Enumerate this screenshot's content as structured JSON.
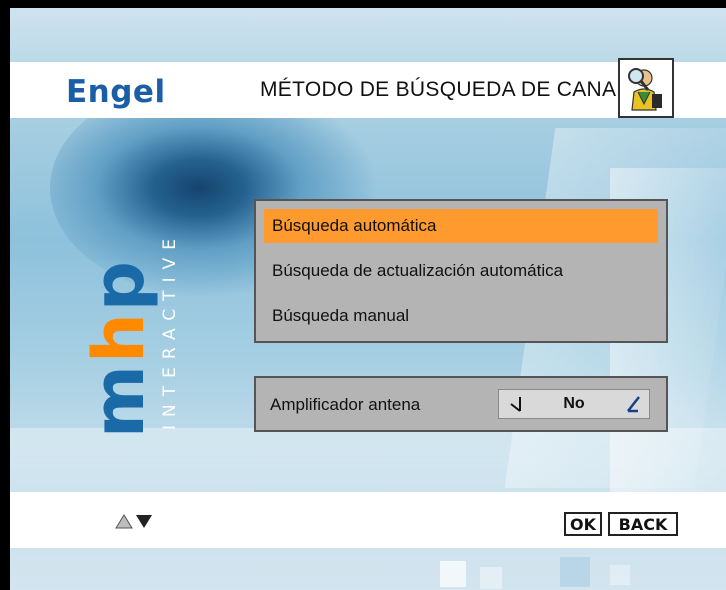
{
  "header": {
    "brand": "Engel",
    "title": "MÉTODO DE BÚSQUEDA DE CANALES",
    "icon": "user-with-magnifier-icon"
  },
  "logo": {
    "mhp": "m",
    "mhp_h": "h",
    "mhp_p": "p",
    "interactive": "INTERACTIVE"
  },
  "menu": {
    "items": [
      {
        "label": "Búsqueda automática",
        "selected": true
      },
      {
        "label": "Búsqueda de actualización automática",
        "selected": false
      },
      {
        "label": "Búsqueda manual",
        "selected": false
      }
    ]
  },
  "amplifier": {
    "label": "Amplificador antena",
    "value": "No"
  },
  "footer": {
    "ok": "OK",
    "back": "BACK"
  },
  "colors": {
    "selected": "#ff9a2e",
    "panel": "#b4b4b4",
    "brand": "#1a5ea6",
    "accent": "#ff8a00"
  }
}
